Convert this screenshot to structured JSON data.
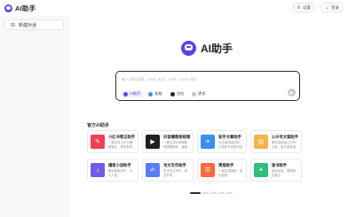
{
  "app": {
    "title": "AI助手"
  },
  "header": {
    "actions": [
      {
        "icon": "settings-icon",
        "label": "设置"
      },
      {
        "icon": "user-icon",
        "label": "登录"
      }
    ]
  },
  "sidebar": {
    "new_chat_label": "新建对话"
  },
  "hero": {
    "title": "AI助手"
  },
  "chat": {
    "placeholder": "输入你的问题，Enter 发送，Shift + Enter 换行",
    "tools": [
      {
        "label": "AI助手",
        "icon": "assistant-icon",
        "active": true,
        "color": "#5a46e8"
      },
      {
        "label": "智能",
        "icon": "smart-icon",
        "active": false,
        "color": "#3a8ef0"
      },
      {
        "label": "文档",
        "icon": "document-icon",
        "active": false,
        "color": "#222222"
      },
      {
        "label": "更多",
        "icon": "more-icon",
        "active": false,
        "color": "#999999"
      }
    ]
  },
  "assistants": {
    "section_title": "官方AI助手",
    "items": [
      {
        "title": "小红书笔记助手",
        "desc": "一键生成小红书爆款笔记，带你发现好物",
        "color": "#ef4055",
        "icon": "notebook-icon"
      },
      {
        "title": "抖音爆款短视频",
        "desc": "一键生成抖音爆款短视频脚本，速涨粉丝",
        "color": "#1f1f1f",
        "icon": "video-icon"
      },
      {
        "title": "知乎文章助手",
        "desc": "专业高质量回答，打造知乎优质内容",
        "color": "#3a8ef0",
        "icon": "article-icon"
      },
      {
        "title": "公众号文案助手",
        "desc": "撰写高质量公众号文案，吸引更多读者",
        "color": "#f1b54a",
        "icon": "doc-icon"
      },
      {
        "title": "播客小说助手",
        "desc": "精彩故事创作，引人入胜",
        "color": "#6c5ce7",
        "icon": "podcast-icon"
      },
      {
        "title": "论文写作助手",
        "desc": "学术论文写作，规范严谨",
        "color": "#5b7cfa",
        "icon": "paper-icon"
      },
      {
        "title": "周报助手",
        "desc": "一键生成周报，告别加班",
        "color": "#ff6a3d",
        "icon": "report-icon"
      },
      {
        "title": "读书助手",
        "desc": "高效阅读，提炼精华要点",
        "color": "#2dbf7b",
        "icon": "book-icon"
      }
    ]
  },
  "pager": {
    "total": 5,
    "current": 1
  }
}
